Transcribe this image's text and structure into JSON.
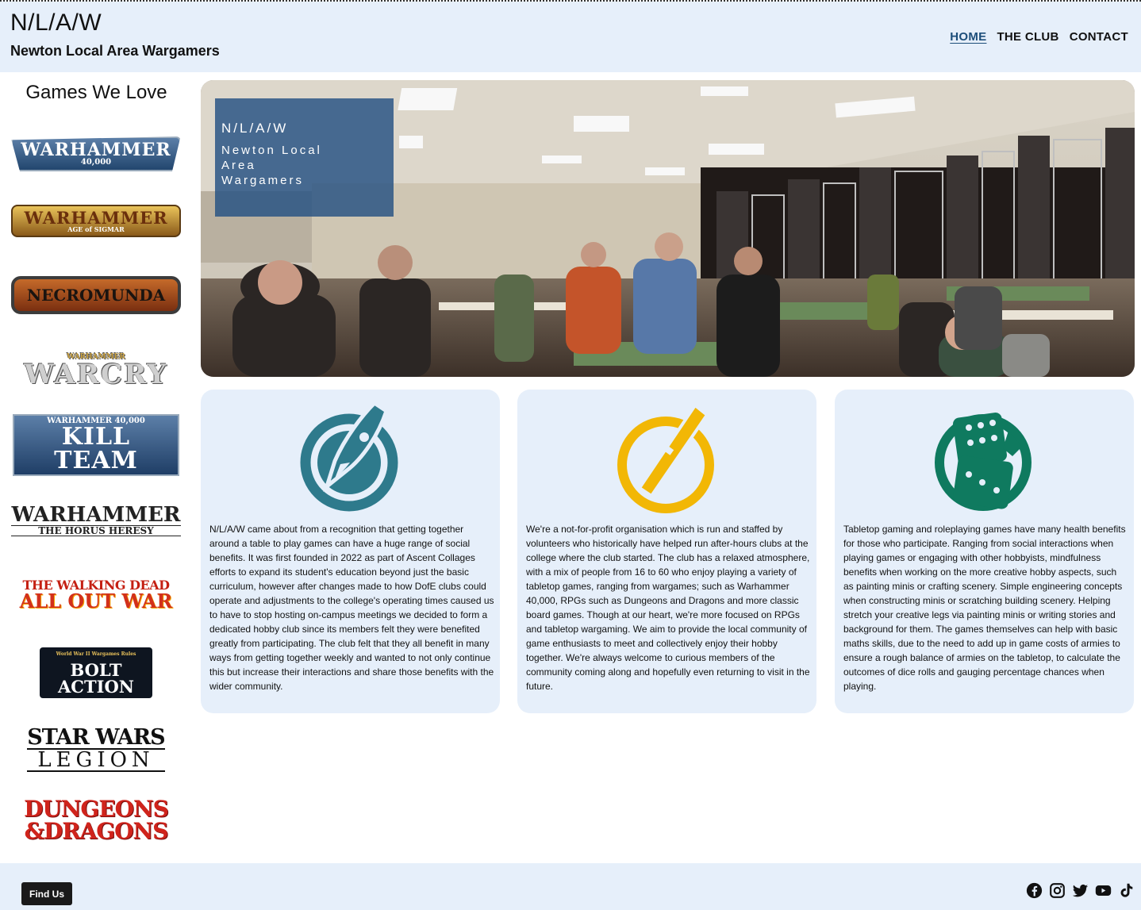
{
  "header": {
    "abbr": "N/L/A/W",
    "full_name": "Newton Local Area Wargamers",
    "nav": [
      "HOME",
      "THE CLUB",
      "CONTACT"
    ]
  },
  "sidebar": {
    "title": "Games We Love",
    "logos": [
      {
        "name": "warhammer-40000-logo",
        "line1": "WARHAMMER",
        "line2": "40,000"
      },
      {
        "name": "age-of-sigmar-logo",
        "line1": "WARHAMMER",
        "line2": "AGE of SIGMAR"
      },
      {
        "name": "necromunda-logo",
        "line1": "NECROMUNDA",
        "line2": ""
      },
      {
        "name": "warcry-logo",
        "line1": "WARCRY",
        "line2": "WARHAMMER"
      },
      {
        "name": "kill-team-logo",
        "line1": "KILL TEAM",
        "line2": "WARHAMMER 40,000"
      },
      {
        "name": "horus-heresy-logo",
        "line1": "WARHAMMER",
        "line2": "THE HORUS HERESY"
      },
      {
        "name": "walking-dead-logo",
        "line1": "THE WALKING DEAD",
        "line2": "ALL OUT WAR"
      },
      {
        "name": "bolt-action-logo",
        "line1": "BOLT ACTION",
        "line2": "World War II Wargames Rules"
      },
      {
        "name": "star-wars-legion-logo",
        "line1": "STAR WARS",
        "line2": "LEGION"
      },
      {
        "name": "dungeons-dragons-logo",
        "line1": "DUNGEONS",
        "line2": "&DRAGONS"
      }
    ]
  },
  "hero": {
    "abbr": "N/L/A/W",
    "full_name": "Newton Local Area Wargamers"
  },
  "cards": [
    {
      "icon": "rocket-icon",
      "color": "#2e7a8c",
      "text": "N/L/A/W came about from a recognition that getting together around a table to play games can have a huge range of social benefits. It was first founded in 2022 as part of Ascent Collages efforts to expand its student's education beyond just the basic curriculum, however after changes made to how DofE clubs could operate and adjustments to the college's operating times caused us to have to stop hosting on-campus meetings we decided to form a dedicated hobby club since its members felt they were benefited greatly from participating. The club felt that they all benefit in many ways from getting together weekly and wanted to not only continue this but increase their interactions and share those benefits with the wider community."
    },
    {
      "icon": "paintbrush-icon",
      "color": "#f2b705",
      "text": "We're a not-for-profit organisation which is run and staffed by volunteers who historically have helped run after-hours clubs at the college where the club started. The club has a relaxed atmosphere, with a mix of people from 16 to 60 who enjoy playing a variety of tabletop games, ranging from wargames; such as Warhammer 40,000, RPGs such as Dungeons and Dragons and more classic board games. Though at our heart, we're more focused on RPGs and tabletop wargaming. We aim to provide the local community of game enthusiasts to meet and collectively enjoy their hobby together. We're always welcome to curious members of the community coming along and hopefully even returning to visit in the future."
    },
    {
      "icon": "dice-icon",
      "color": "#0f7a5f",
      "text": "Tabletop gaming and roleplaying games have many health benefits for those who participate. Ranging from social interactions when playing games or engaging with other hobbyists, mindfulness benefits when working on the more creative hobby aspects, such as painting minis or crafting scenery. Simple engineering concepts when constructing minis or scratching building scenery. Helping stretch your creative legs via painting minis or writing stories and background for them. The games themselves can help with basic maths skills, due to the need to add up in game costs of armies to ensure a rough balance of armies on the tabletop, to calculate the outcomes of dice rolls and gauging percentage chances when playing."
    }
  ],
  "footer": {
    "find_us": "Find Us",
    "socials": [
      "facebook-icon",
      "instagram-icon",
      "twitter-icon",
      "youtube-icon",
      "tiktok-icon"
    ]
  }
}
